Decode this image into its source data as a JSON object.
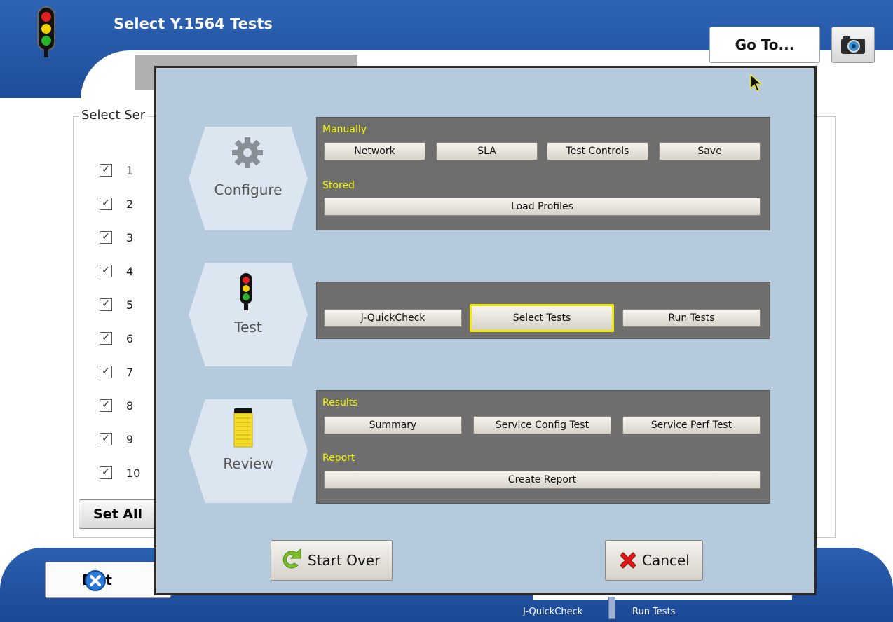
{
  "app": {
    "title": "Select Y.1564 Tests",
    "goto_label": "Go To...",
    "camera_icon": "camera-icon",
    "traffic_icon": "traffic-light-icon"
  },
  "background": {
    "panel_title": "Select Ser",
    "services": [
      "1",
      "2",
      "3",
      "4",
      "5",
      "6",
      "7",
      "8",
      "9",
      "10"
    ],
    "service_checked": [
      true,
      true,
      true,
      true,
      true,
      true,
      true,
      true,
      true,
      true
    ],
    "set_all_label": "Set All",
    "exit_label": "Exit",
    "bottom_tabs": {
      "jquickcheck": "J-QuickCheck",
      "run_tests": "Run Tests"
    }
  },
  "dialog": {
    "configure": {
      "label": "Configure",
      "icon": "gear-icon",
      "manually_label": "Manually",
      "manually_buttons": [
        "Network",
        "SLA",
        "Test Controls",
        "Save"
      ],
      "stored_label": "Stored",
      "stored_button": "Load Profiles"
    },
    "test": {
      "label": "Test",
      "icon": "traffic-light-icon",
      "buttons": [
        "J-QuickCheck",
        "Select Tests",
        "Run Tests"
      ],
      "selected": "Select Tests"
    },
    "review": {
      "label": "Review",
      "icon": "notepad-icon",
      "results_label": "Results",
      "results_buttons": [
        "Summary",
        "Service Config Test",
        "Service Perf Test"
      ],
      "report_label": "Report",
      "report_button": "Create Report"
    },
    "start_over_label": "Start Over",
    "cancel_label": "Cancel"
  },
  "colors": {
    "header_blue": "#2d64b4",
    "dialog_bg": "#b6cadd",
    "group_bg": "#6e6e6e",
    "group_label": "#f6f600",
    "selected_border": "#f4e900"
  }
}
